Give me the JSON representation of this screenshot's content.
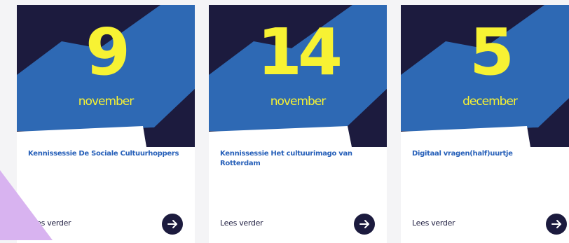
{
  "cards": [
    {
      "day": "9",
      "month": "november",
      "title": "Kennissessie De Sociale Cultuurhoppers",
      "read_more": "Lees verder"
    },
    {
      "day": "14",
      "month": "november",
      "title": "Kennissessie Het cultuurimago van Rotterdam",
      "read_more": "Lees verder"
    },
    {
      "day": "5",
      "month": "december",
      "title": "Digitaal vragen(half)uurtje",
      "read_more": "Lees verder"
    }
  ],
  "icons": {
    "card_button": "arrow-right-icon"
  },
  "colors": {
    "page_background": "#f4f4f6",
    "hero_dark": "#1c1b3e",
    "hero_blue": "#2e69b4",
    "date_yellow": "#f7f233",
    "title_blue": "#2760b9",
    "corner_lilac": "#d8b3f0"
  }
}
